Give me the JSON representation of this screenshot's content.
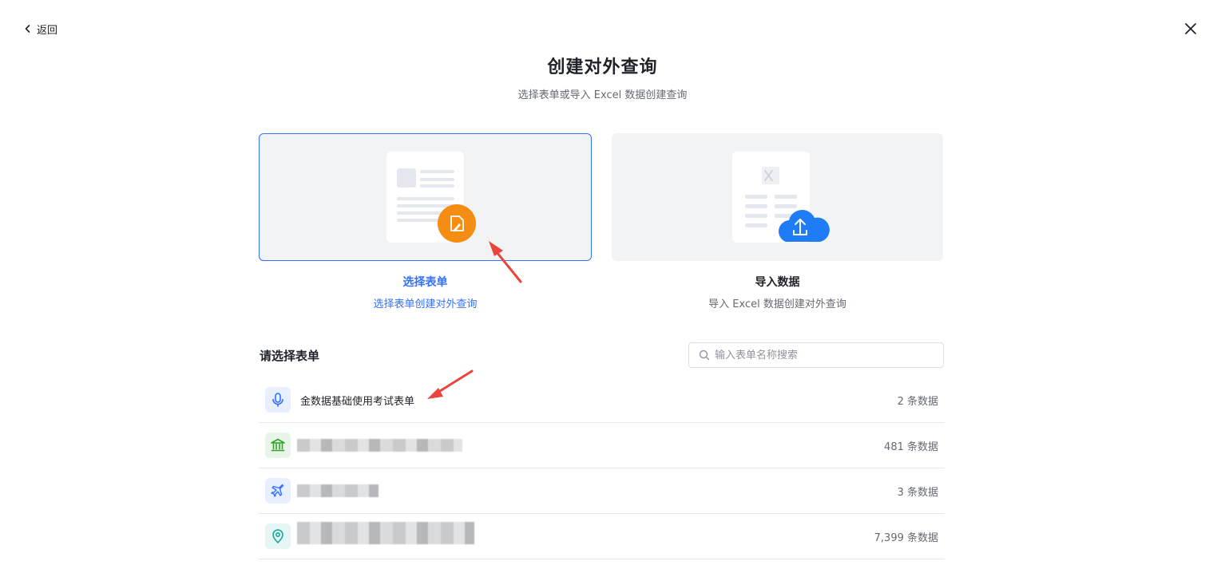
{
  "nav": {
    "back_label": "返回"
  },
  "header": {
    "title": "创建对外查询",
    "subtitle": "选择表单或导入 Excel 数据创建查询"
  },
  "options": [
    {
      "name": "选择表单",
      "desc": "选择表单创建对外查询",
      "selected": true
    },
    {
      "name": "导入数据",
      "desc": "导入 Excel 数据创建对外查询",
      "selected": false
    }
  ],
  "form_list": {
    "label": "请选择表单",
    "search_placeholder": "输入表单名称搜索",
    "items": [
      {
        "icon": "microphone-icon",
        "name": "金数据基础使用考试表单",
        "count": "2 条数据",
        "icon_color": "#3370ff"
      },
      {
        "icon": "bank-icon",
        "name": "",
        "count": "481 条数据",
        "icon_color": "#2ea121"
      },
      {
        "icon": "airplane-icon",
        "name": "",
        "count": "3 条数据",
        "icon_color": "#3370ff"
      },
      {
        "icon": "location-pin-icon",
        "name": "",
        "count": "7,399 条数据",
        "icon_color": "#14a89c"
      }
    ]
  },
  "colors": {
    "accent": "#3370ff",
    "orange": "#f58d13",
    "upload_blue": "#1e7cf7",
    "annotation_red": "#e8453c"
  }
}
